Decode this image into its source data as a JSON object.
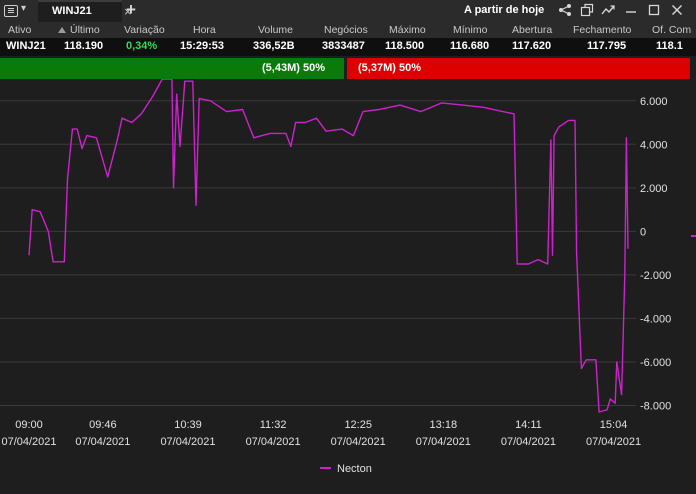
{
  "window": {
    "tab_label": "WINJ21",
    "tab_close": "×",
    "add_tab": "+",
    "period_label": "A partir de hoje"
  },
  "quote": {
    "headers": [
      "Ativo",
      "Último",
      "Variação",
      "Hora",
      "Volume",
      "Negócios",
      "Máximo",
      "Mínimo",
      "Abertura",
      "Fechamento",
      "Of. Com"
    ],
    "values": [
      "WINJ21",
      "118.190",
      "0,34%",
      "15:29:53",
      "336,52B",
      "3833487",
      "118.500",
      "116.680",
      "117.620",
      "117.795",
      "118.1"
    ]
  },
  "aggression": {
    "buy_label": "(5,43M) 50%",
    "sell_label": "(5,37M) 50%",
    "buy_color": "#0a7a0a",
    "sell_color": "#dd0000"
  },
  "icons": [
    "app-menu-icon",
    "share-icon",
    "window-tile-icon",
    "chart-trend-icon",
    "minimize-icon",
    "maximize-icon",
    "close-icon"
  ],
  "chart_data": {
    "type": "line",
    "y_ticks": [
      "6.000",
      "4.000",
      "2.000",
      "0",
      "-2.000",
      "-4.000",
      "-6.000",
      "-8.000"
    ],
    "ylim": [
      -8300,
      7000
    ],
    "x_ticks": [
      {
        "time": "09:00",
        "date": "07/04/2021"
      },
      {
        "time": "09:46",
        "date": "07/04/2021"
      },
      {
        "time": "10:39",
        "date": "07/04/2021"
      },
      {
        "time": "11:32",
        "date": "07/04/2021"
      },
      {
        "time": "12:25",
        "date": "07/04/2021"
      },
      {
        "time": "13:18",
        "date": "07/04/2021"
      },
      {
        "time": "14:11",
        "date": "07/04/2021"
      },
      {
        "time": "15:04",
        "date": "07/04/2021"
      }
    ],
    "grid": true,
    "legend_position": "bottom-center",
    "series": [
      {
        "name": "Necton",
        "color": "#cc22cc",
        "points": [
          [
            "09:00",
            -1100
          ],
          [
            "09:02",
            1000
          ],
          [
            "09:07",
            900
          ],
          [
            "09:12",
            0
          ],
          [
            "09:15",
            -1400
          ],
          [
            "09:22",
            -1400
          ],
          [
            "09:24",
            2400
          ],
          [
            "09:27",
            4700
          ],
          [
            "09:30",
            4700
          ],
          [
            "09:33",
            3800
          ],
          [
            "09:36",
            4400
          ],
          [
            "09:42",
            4300
          ],
          [
            "09:49",
            2500
          ],
          [
            "09:55",
            4200
          ],
          [
            "09:58",
            5200
          ],
          [
            "10:04",
            5000
          ],
          [
            "10:10",
            5400
          ],
          [
            "10:17",
            6200
          ],
          [
            "10:23",
            7000
          ],
          [
            "10:29",
            7000
          ],
          [
            "10:30",
            2000
          ],
          [
            "10:32",
            6300
          ],
          [
            "10:34",
            3900
          ],
          [
            "10:37",
            6900
          ],
          [
            "10:42",
            6900
          ],
          [
            "10:44",
            1200
          ],
          [
            "10:46",
            6100
          ],
          [
            "10:53",
            6000
          ],
          [
            "11:03",
            5500
          ],
          [
            "11:13",
            5600
          ],
          [
            "11:20",
            4300
          ],
          [
            "11:30",
            4500
          ],
          [
            "11:40",
            4500
          ],
          [
            "11:43",
            3900
          ],
          [
            "11:46",
            5000
          ],
          [
            "11:52",
            5000
          ],
          [
            "11:59",
            5200
          ],
          [
            "12:05",
            4600
          ],
          [
            "12:15",
            4700
          ],
          [
            "12:22",
            4400
          ],
          [
            "12:28",
            5500
          ],
          [
            "12:38",
            5600
          ],
          [
            "12:51",
            5800
          ],
          [
            "13:04",
            5500
          ],
          [
            "13:17",
            5900
          ],
          [
            "13:30",
            5800
          ],
          [
            "13:43",
            5700
          ],
          [
            "13:55",
            5500
          ],
          [
            "14:02",
            5400
          ],
          [
            "14:04",
            -1500
          ],
          [
            "14:11",
            -1500
          ],
          [
            "14:17",
            -1300
          ],
          [
            "14:23",
            -1500
          ],
          [
            "14:25",
            4200
          ],
          [
            "14:26",
            -1100
          ],
          [
            "14:27",
            4400
          ],
          [
            "14:30",
            4800
          ],
          [
            "14:36",
            5100
          ],
          [
            "14:40",
            5100
          ],
          [
            "14:41",
            -1000
          ],
          [
            "14:44",
            -6300
          ],
          [
            "14:47",
            -5900
          ],
          [
            "14:53",
            -5900
          ],
          [
            "14:55",
            -8300
          ],
          [
            "15:00",
            -8200
          ],
          [
            "15:02",
            -7700
          ],
          [
            "15:05",
            -7900
          ],
          [
            "15:06",
            -6000
          ],
          [
            "15:09",
            -7500
          ],
          [
            "15:11",
            -2000
          ],
          [
            "15:12",
            4300
          ],
          [
            "15:13",
            -800
          ]
        ]
      }
    ]
  }
}
